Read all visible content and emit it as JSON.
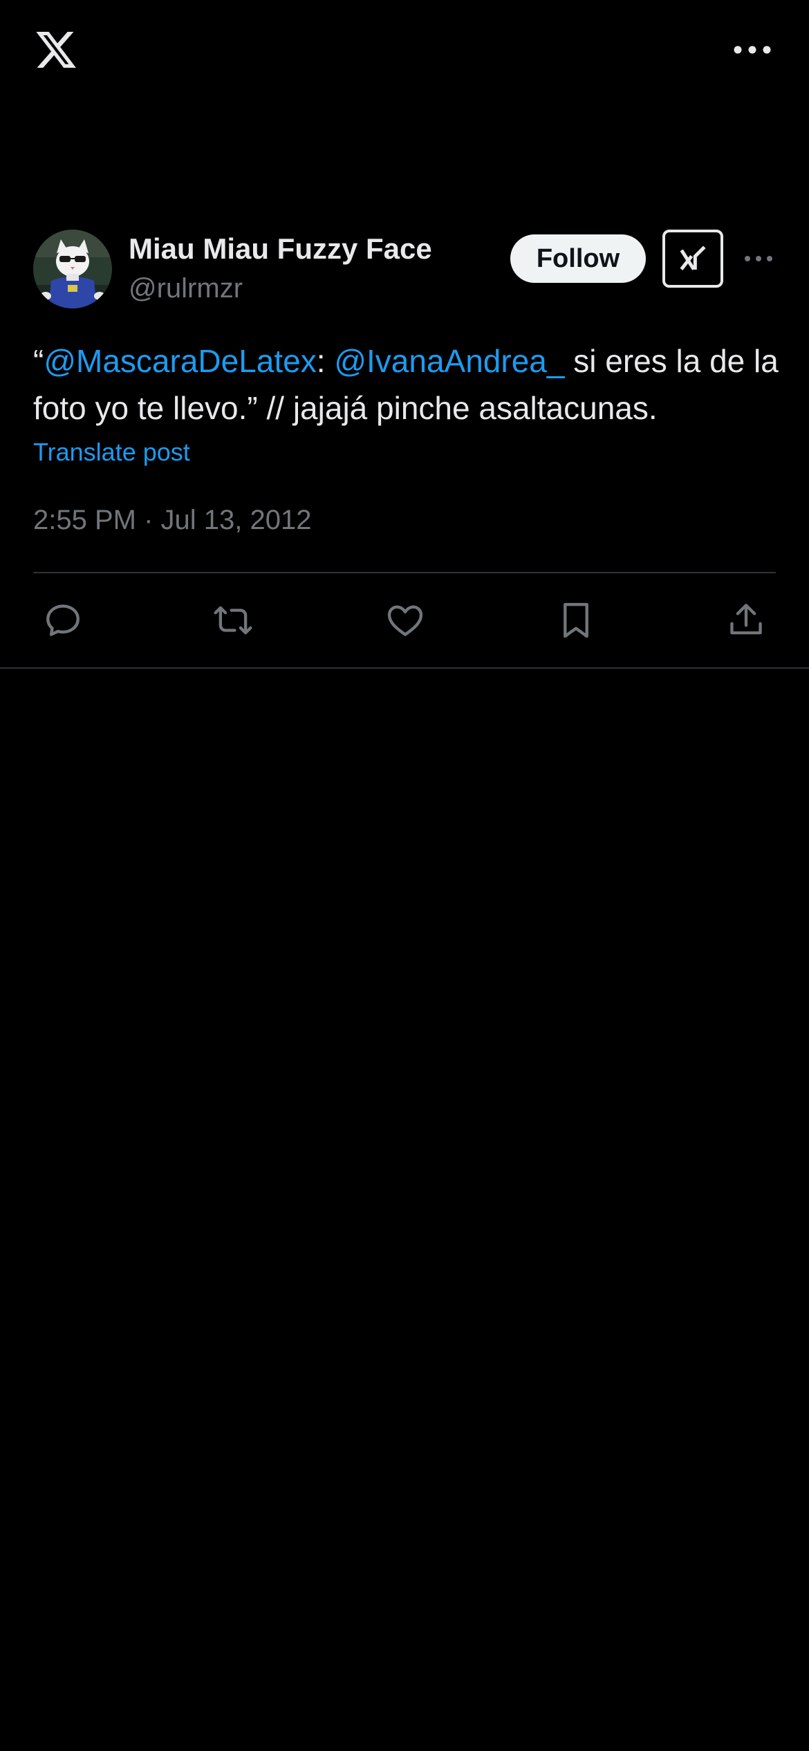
{
  "post": {
    "author": {
      "display_name": "Miau Miau Fuzzy Face",
      "handle": "@rulrmzr"
    },
    "follow_label": "Follow",
    "text_segments": {
      "open_quote": "“",
      "mention_1": "@MascaraDeLatex",
      "colon": ": ",
      "mention_2": "@IvanaAndrea_",
      "rest": " si eres la de la foto yo te llevo.” // jajajá pinche asaltacunas."
    },
    "translate_label": "Translate post",
    "timestamp": "2:55 PM · Jul 13, 2012"
  },
  "icons": {
    "logo": "x-logo-icon",
    "top_more": "more-horizontal-icon",
    "grok": "grok-icon",
    "post_more": "more-horizontal-icon",
    "actions": [
      "reply-icon",
      "repost-icon",
      "like-icon",
      "bookmark-icon",
      "share-icon"
    ]
  },
  "colors": {
    "background": "#000000",
    "text": "#e7e9ea",
    "secondary": "#71767b",
    "link": "#1d9bf0",
    "divider": "#2f3336",
    "follow_bg": "#eff3f4"
  }
}
